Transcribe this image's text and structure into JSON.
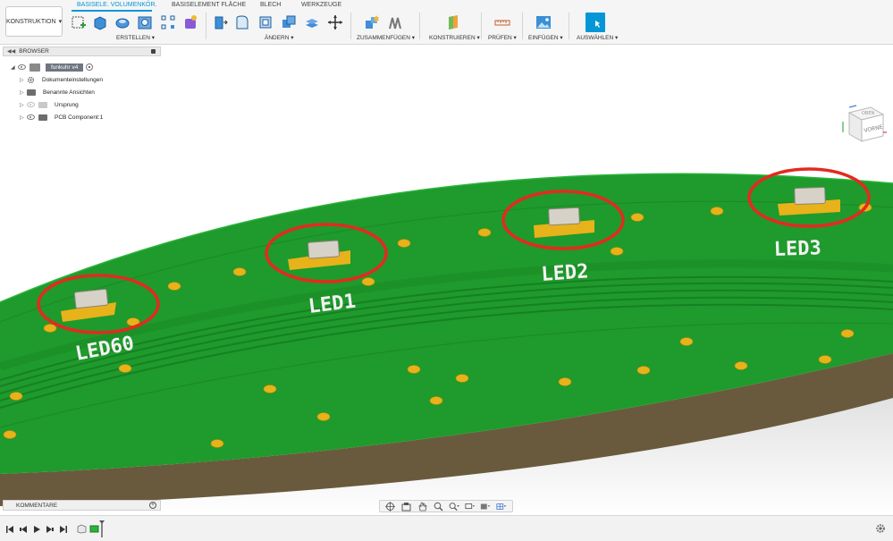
{
  "toolbar": {
    "workspace": "KONSTRUKTION",
    "tabs": [
      {
        "label": "BASISELE. VOLUMENKÖR.",
        "active": true
      },
      {
        "label": "BASISELEMENT FLÄCHE",
        "active": false
      },
      {
        "label": "BLECH",
        "active": false
      },
      {
        "label": "WERKZEUGE",
        "active": false
      }
    ],
    "groups": {
      "erstellen": "ERSTELLEN ▾",
      "aendern": "ÄNDERN ▾",
      "zusammenfuegen": "ZUSAMMENFÜGEN ▾",
      "konstruieren": "KONSTRUIEREN ▾",
      "pruefen": "PRÜFEN ▾",
      "einfuegen": "EINFÜGEN ▾",
      "auswaehlen": "AUSWÄHLEN ▾"
    },
    "accent_color": "#0696d7"
  },
  "browser": {
    "title": "BROWSER",
    "root": "funkuhr v4",
    "items": [
      {
        "label": "Dokumenteinstellungen",
        "icon": "gear-icon"
      },
      {
        "label": "Benannte Ansichten",
        "icon": "folder-icon"
      },
      {
        "label": "Ursprung",
        "icon": "folder-icon"
      },
      {
        "label": "PCB Component:1",
        "icon": "folder-icon"
      }
    ]
  },
  "viewcube": {
    "face": "VORNE",
    "top_face": "OBEN"
  },
  "comments": {
    "title": "KOMMENTARE"
  },
  "board": {
    "pcb_color": "#1f9a2c",
    "pad_color": "#e8b21a",
    "highlight_color": "#e42a1f",
    "labels": [
      "LED60",
      "LED1",
      "LED2",
      "LED3"
    ]
  }
}
